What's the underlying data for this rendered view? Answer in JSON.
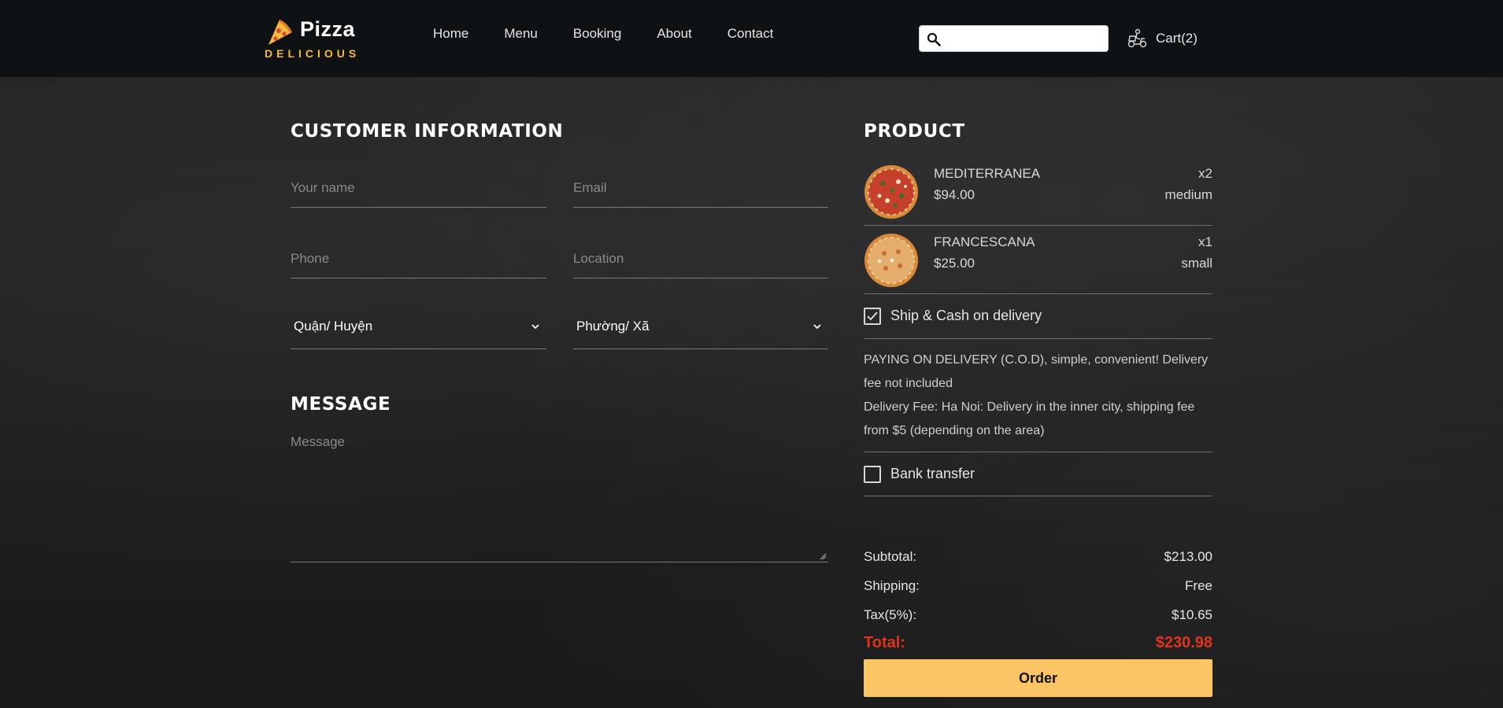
{
  "brand": {
    "name": "Pizza",
    "tagline": "DELICIOUS",
    "accent_color": "#f6b93b"
  },
  "nav": {
    "items": [
      {
        "label": "Home"
      },
      {
        "label": "Menu"
      },
      {
        "label": "Booking"
      },
      {
        "label": "About"
      },
      {
        "label": "Contact"
      }
    ]
  },
  "search": {
    "placeholder": "",
    "value": ""
  },
  "cart": {
    "label": "Cart(2)"
  },
  "customer": {
    "title": "CUSTOMER INFORMATION",
    "name_placeholder": "Your name",
    "email_placeholder": "Email",
    "phone_placeholder": "Phone",
    "location_placeholder": "Location",
    "district_selected": "Quận/ Huyện",
    "ward_selected": "Phường/ Xã"
  },
  "message": {
    "title": "MESSAGE",
    "placeholder": "Message"
  },
  "product": {
    "title": "PRODUCT",
    "items": [
      {
        "name": "MEDITERRANEA",
        "price": "$94.00",
        "qty": "x2",
        "size": "medium"
      },
      {
        "name": "FRANCESCANA",
        "price": "$25.00",
        "qty": "x1",
        "size": "small"
      }
    ]
  },
  "payment": {
    "cod_label": "Ship & Cash on delivery",
    "cod_checked": true,
    "cod_desc_1": "PAYING ON DELIVERY (C.O.D), simple, convenient! Delivery fee not included",
    "cod_desc_2": "Delivery Fee: Ha Noi: Delivery in the inner city, shipping fee from $5 (depending on the area)",
    "bank_label": "Bank transfer",
    "bank_checked": false
  },
  "summary": {
    "subtotal_label": "Subtotal:",
    "subtotal_value": "$213.00",
    "shipping_label": "Shipping:",
    "shipping_value": "Free",
    "tax_label": "Tax(5%):",
    "tax_value": "$10.65",
    "total_label": "Total:",
    "total_value": "$230.98",
    "total_color": "#e0341d"
  },
  "order_button": {
    "label": "Order",
    "color": "#fbc565"
  }
}
